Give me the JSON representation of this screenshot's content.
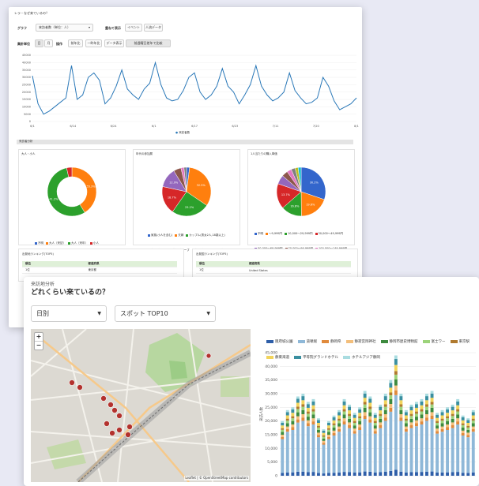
{
  "back": {
    "title": "レラ・なぜ来ているの？",
    "graph_label": "グラフ",
    "graph_select": "来訪者数（単位：人）",
    "overlay_label": "重ねて表示",
    "overlay_buttons": [
      "イベント",
      "人流データ"
    ],
    "period_label": "集計単位",
    "period_buttons": [
      "日",
      "月"
    ],
    "ops_label": "操作",
    "ops_buttons": [
      "前年比",
      "一昨年比",
      "データ表示",
      "前週曜日差年で比較"
    ],
    "line_chart": {
      "y_ticks": [
        "45000",
        "40000",
        "35000",
        "30000",
        "25000",
        "20000",
        "15000",
        "10000",
        "5000",
        "0"
      ],
      "x_ticks": [
        "6/1",
        "6/14",
        "6/24",
        "6/1",
        "6/17",
        "6/23",
        "7/11",
        "7/20",
        "8/1"
      ],
      "legend": "来訪者数"
    },
    "section_title": "来訪者分析",
    "pie1": {
      "title": "大人・小人",
      "labels": [
        "41.2%",
        "55.3%"
      ],
      "legend": [
        "不明",
        "大人（来訪）",
        "大人（来年）",
        "小人"
      ],
      "colors": [
        "#3366cc",
        "#ff7f0e",
        "#2ca02c",
        "#d62728"
      ]
    },
    "pie2": {
      "title": "年代の参加層",
      "labels": [
        "32.5%",
        "25.2%",
        "18.7%",
        "12.9%"
      ],
      "legend": [
        "家族(小人を含む)",
        "夫婦",
        "カップル(男女2人,18歳以上)",
        "友達グループ",
        "単独グループ",
        "友人グループ(小人を含む)",
        "外国人観光客",
        "一人"
      ],
      "colors": [
        "#3366cc",
        "#ff7f0e",
        "#2ca02c",
        "#d62728",
        "#9467bd",
        "#8c564b",
        "#e377c2",
        "#7f7f7f"
      ]
    },
    "pie3": {
      "title": "1人当たりの購入単価",
      "labels": [
        "30.2%",
        "19.6%",
        "13.7%",
        "16.8%"
      ],
      "legend": [
        "不明",
        "〜9,999円",
        "10,000〜29,999円",
        "30,000〜49,999円",
        "50,000〜69,999円",
        "70,000〜99,999円",
        "100,000〜149,999円",
        "150,000〜199,999円",
        "200,000〜299,999円",
        "300,000円〜"
      ],
      "colors": [
        "#3366cc",
        "#ff7f0e",
        "#2ca02c",
        "#d62728",
        "#9467bd",
        "#8c564b",
        "#e377c2",
        "#7f7f7f",
        "#bcbd22",
        "#17becf"
      ]
    },
    "rank1": {
      "title": "出発地ランキング(TOP5)",
      "headers": [
        "順位",
        "都道府県"
      ],
      "rows": [
        [
          "1位",
          "東京都"
        ]
      ]
    },
    "rank2": {
      "title": "出発国ランキング(TOP5)",
      "headers": [
        "順位",
        "都道府県"
      ],
      "rows": [
        [
          "1位",
          "United States"
        ]
      ]
    }
  },
  "front": {
    "subtitle": "来訪地分析",
    "title": "どれくらい来ているの？",
    "select1": "日別",
    "select2": "スポット TOP10",
    "zoom_in": "+",
    "zoom_out": "−",
    "attribution": "Leaflet | © OpenStreetMap contributors",
    "chart": {
      "legend": [
        "阪府城公園",
        "道頓堀",
        "静岡県",
        "静寂宮岡神社",
        "静岡市歴史博物館",
        "富士ワー",
        "東京駅",
        "静東海道",
        "平等院グランドホテル",
        "ホテルアジア静岡"
      ],
      "colors": [
        "#2e5ea8",
        "#8fb8d8",
        "#e08a3c",
        "#f3bf7c",
        "#3d8a3e",
        "#9cd37a",
        "#b07a2e",
        "#f2d45c",
        "#3a8fa0",
        "#a9dce0"
      ],
      "ylabel": "来訪人数",
      "y_ticks": [
        "45,000",
        "40,000",
        "35,000",
        "30,000",
        "25,000",
        "20,000",
        "15,000",
        "10,000",
        "5,000",
        "0"
      ]
    }
  },
  "chart_data": [
    {
      "type": "line",
      "series": [
        {
          "name": "来訪者数",
          "values": [
            31000,
            12000,
            5000,
            7000,
            10000,
            13000,
            16000,
            38000,
            15000,
            18000,
            30000,
            33000,
            28000,
            12000,
            16000,
            24000,
            35000,
            22000,
            18000,
            15000,
            22000,
            26000,
            40000,
            25000,
            16000,
            14000,
            15000,
            21000,
            30000,
            33000,
            20000,
            15000,
            18000,
            24000,
            36000,
            24000,
            20000,
            12000,
            18000,
            25000,
            38000,
            24000,
            18000,
            14000,
            16000,
            20000,
            33000,
            21000,
            16000,
            12000,
            13000,
            16000,
            30000,
            24000,
            14000,
            8000,
            10000,
            12000,
            16000
          ]
        }
      ],
      "ylim": [
        0,
        45000
      ],
      "legend": "bottom"
    },
    {
      "type": "pie",
      "labels": [
        "不明",
        "大人（来訪）",
        "大人（来年）",
        "小人"
      ],
      "values": [
        0,
        41.2,
        55.3,
        3.5
      ]
    },
    {
      "type": "pie",
      "labels": [
        "家族(小人を含む)",
        "夫婦",
        "カップル(男女2人,18歳以上)",
        "友達グループ",
        "単独グループ",
        "友人グループ(小人を含む)",
        "外国人観光客",
        "一人"
      ],
      "values": [
        2,
        32.5,
        25.2,
        18.7,
        12.9,
        5,
        2,
        1.7
      ]
    },
    {
      "type": "pie",
      "labels": [
        "不明",
        "〜9,999円",
        "10,000〜29,999円",
        "30,000〜49,999円",
        "50,000〜69,999円",
        "70,000〜99,999円",
        "100,000〜149,999円",
        "150,000〜199,999円",
        "200,000〜299,999円",
        "300,000円〜"
      ],
      "values": [
        30.2,
        19.6,
        13.7,
        16.8,
        6,
        4,
        3,
        2.7,
        2,
        2
      ]
    },
    {
      "type": "bar",
      "stacked": true,
      "ylim": [
        0,
        45000
      ],
      "totals": [
        20000,
        24000,
        25000,
        29000,
        30000,
        27000,
        28000,
        21000,
        17000,
        20000,
        22000,
        24000,
        28000,
        26000,
        23000,
        25000,
        31000,
        29000,
        23000,
        26000,
        30000,
        35000,
        44000,
        30000,
        24000,
        26000,
        27000,
        28000,
        30000,
        31000,
        23000,
        24000,
        25000,
        26000,
        28000,
        22000,
        21000,
        24000
      ]
    }
  ]
}
